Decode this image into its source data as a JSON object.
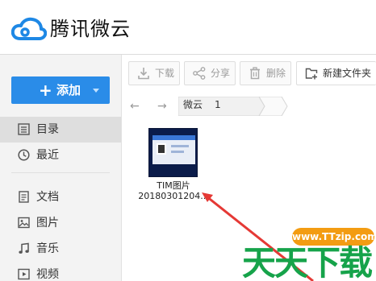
{
  "app": {
    "title": "腾讯微云"
  },
  "sidebar": {
    "add_button": {
      "plus": "+",
      "label": "添加"
    },
    "items": [
      {
        "label": "目录",
        "icon": "list-icon",
        "active": true
      },
      {
        "label": "最近",
        "icon": "clock-icon",
        "active": false
      },
      {
        "label": "文档",
        "icon": "document-icon",
        "active": false
      },
      {
        "label": "图片",
        "icon": "image-icon",
        "active": false
      },
      {
        "label": "音乐",
        "icon": "music-icon",
        "active": false
      },
      {
        "label": "视频",
        "icon": "video-icon",
        "active": false
      }
    ]
  },
  "toolbar": {
    "download": "下载",
    "share": "分享",
    "delete": "删除",
    "new_folder": "新建文件夹"
  },
  "breadcrumb": {
    "back": "←",
    "forward": "→",
    "items": [
      "微云",
      "1"
    ]
  },
  "files": [
    {
      "name_line1": "TIM图片",
      "name_line2": "20180301204..."
    }
  ],
  "watermark": {
    "url": "www.TTzip.com",
    "text": "天天下载"
  },
  "colors": {
    "accent": "#2a8ce8",
    "watermark_orange": "#f39c12",
    "watermark_green": "#16a34a",
    "annotation_arrow": "#e53935"
  }
}
